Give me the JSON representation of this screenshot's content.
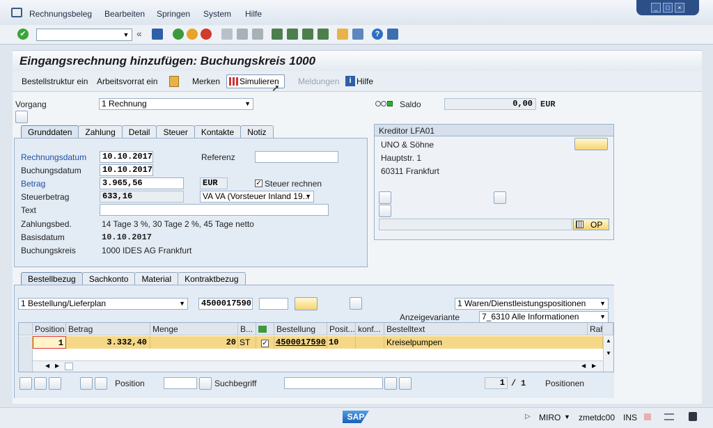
{
  "menu": {
    "items": [
      "Rechnungsbeleg",
      "Bearbeiten",
      "Springen",
      "System",
      "Hilfe"
    ]
  },
  "window": {
    "title": "Eingangsrechnung hinzufügen: Buchungskreis 1000"
  },
  "app_toolbar": {
    "bestellstruktur": "Bestellstruktur ein",
    "arbeitsvorrat": "Arbeitsvorrat ein",
    "merken": "Merken",
    "simulieren": "Simulieren",
    "meldungen": "Meldungen",
    "hilfe": "Hilfe"
  },
  "header": {
    "vorgang_label": "Vorgang",
    "vorgang_value": "1 Rechnung",
    "saldo_label": "Saldo",
    "saldo_value": "0,00",
    "saldo_currency": "EUR"
  },
  "top_tabs": [
    "Grunddaten",
    "Zahlung",
    "Detail",
    "Steuer",
    "Kontakte",
    "Notiz"
  ],
  "grunddaten": {
    "rechnungsdatum_label": "Rechnungsdatum",
    "rechnungsdatum": "10.10.2017",
    "referenz_label": "Referenz",
    "referenz": "",
    "buchungsdatum_label": "Buchungsdatum",
    "buchungsdatum": "10.10.2017",
    "betrag_label": "Betrag",
    "betrag": "3.965,56",
    "currency": "EUR",
    "steuer_rechnen_label": "Steuer rechnen",
    "steuerbetrag_label": "Steuerbetrag",
    "steuerbetrag": "633,16",
    "steuerkz": "VA VA (Vorsteuer Inland 19...",
    "text_label": "Text",
    "text": "",
    "zahlungsbed_label": "Zahlungsbed.",
    "zahlungsbed": "14 Tage 3 %, 30 Tage 2 %, 45 Tage netto",
    "basisdatum_label": "Basisdatum",
    "basisdatum": "10.10.2017",
    "buchungskreis_label": "Buchungskreis",
    "buchungskreis": "1000 IDES AG Frankfurt"
  },
  "kreditor": {
    "title": "Kreditor LFA01",
    "name": "UNO & Söhne",
    "street": "Hauptstr. 1",
    "city": "60311 Frankfurt",
    "op_label": "OP"
  },
  "bottom_tabs": [
    "Bestellbezug",
    "Sachkonto",
    "Material",
    "Kontraktbezug"
  ],
  "bestellbezug": {
    "ref_type": "1 Bestellung/Lieferplan",
    "bestellnummer": "4500017590",
    "positions_type": "1 Waren/Dienstleistungspositionen",
    "anzeigevariante_label": "Anzeigevariante",
    "anzeigevariante": "7_6310 Alle Informationen"
  },
  "grid": {
    "headers": [
      "Position",
      "Betrag",
      "Menge",
      "B...",
      "Bestellung",
      "Posit...",
      "konf...",
      "Bestelltext",
      "Rah"
    ],
    "row": {
      "position": "1",
      "betrag": "3.332,40",
      "menge": "20",
      "bme": "ST",
      "bestellung": "4500017590",
      "posit": "10",
      "konf": "",
      "bestelltext": "Kreiselpumpen"
    }
  },
  "footer": {
    "position_label": "Position",
    "suchbegriff_label": "Suchbegriff",
    "page_current": "1",
    "page_sep": "/",
    "page_total": "1",
    "positionen_label": "Positionen"
  },
  "status": {
    "transaction": "MIRO",
    "server": "zmetdc00",
    "mode": "INS"
  }
}
